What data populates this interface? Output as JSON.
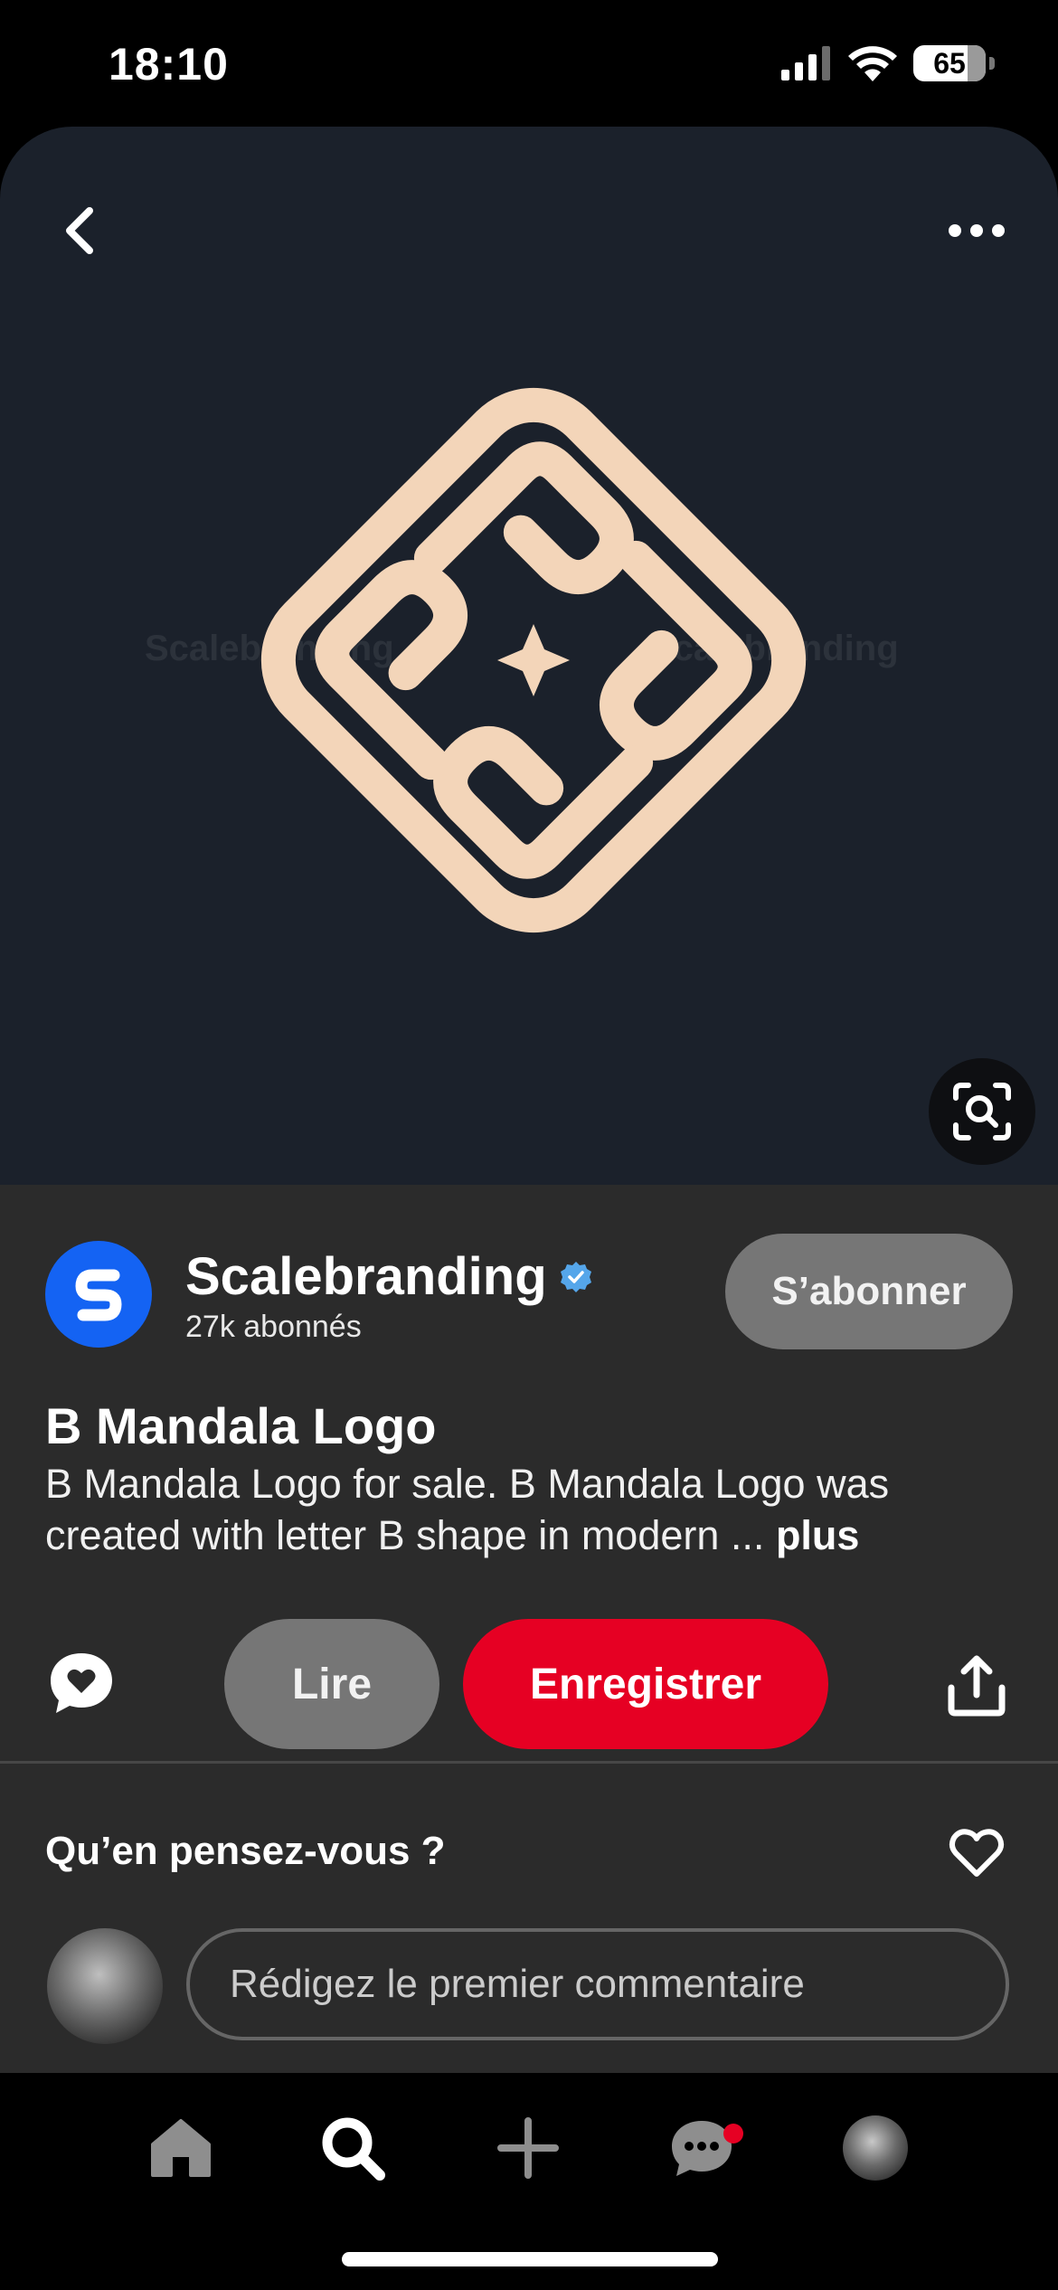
{
  "status_bar": {
    "time": "18:10",
    "battery": "65",
    "icons": [
      "cellular-signal-icon",
      "wifi-icon",
      "battery-icon"
    ]
  },
  "pin": {
    "image_watermark": "Scalebranding",
    "back_icon": "chevron-left-icon",
    "more_icon": "ellipsis-icon",
    "lens_icon": "visual-search-icon",
    "logo_color": "#f3d5b9",
    "background_color": "#1b212b"
  },
  "creator": {
    "name": "Scalebranding",
    "followers": "27k abonnés",
    "subscribe_label": "S’abonner",
    "brand_color": "#1463f3"
  },
  "details": {
    "title": "B Mandala Logo",
    "description": "B Mandala Logo for sale. B Mandala Logo was created with letter B shape in modern ...",
    "more_label": "plus"
  },
  "actions": {
    "read_label": "Lire",
    "save_label": "Enregistrer",
    "save_color": "#e60023"
  },
  "comments": {
    "prompt": "Qu’en pensez-vous ?",
    "input_placeholder": "Rédigez le premier commentaire"
  },
  "tabbar": {
    "items": [
      "home-icon",
      "search-icon",
      "add-icon",
      "messages-icon",
      "profile-icon"
    ],
    "messages_has_notification": true
  }
}
